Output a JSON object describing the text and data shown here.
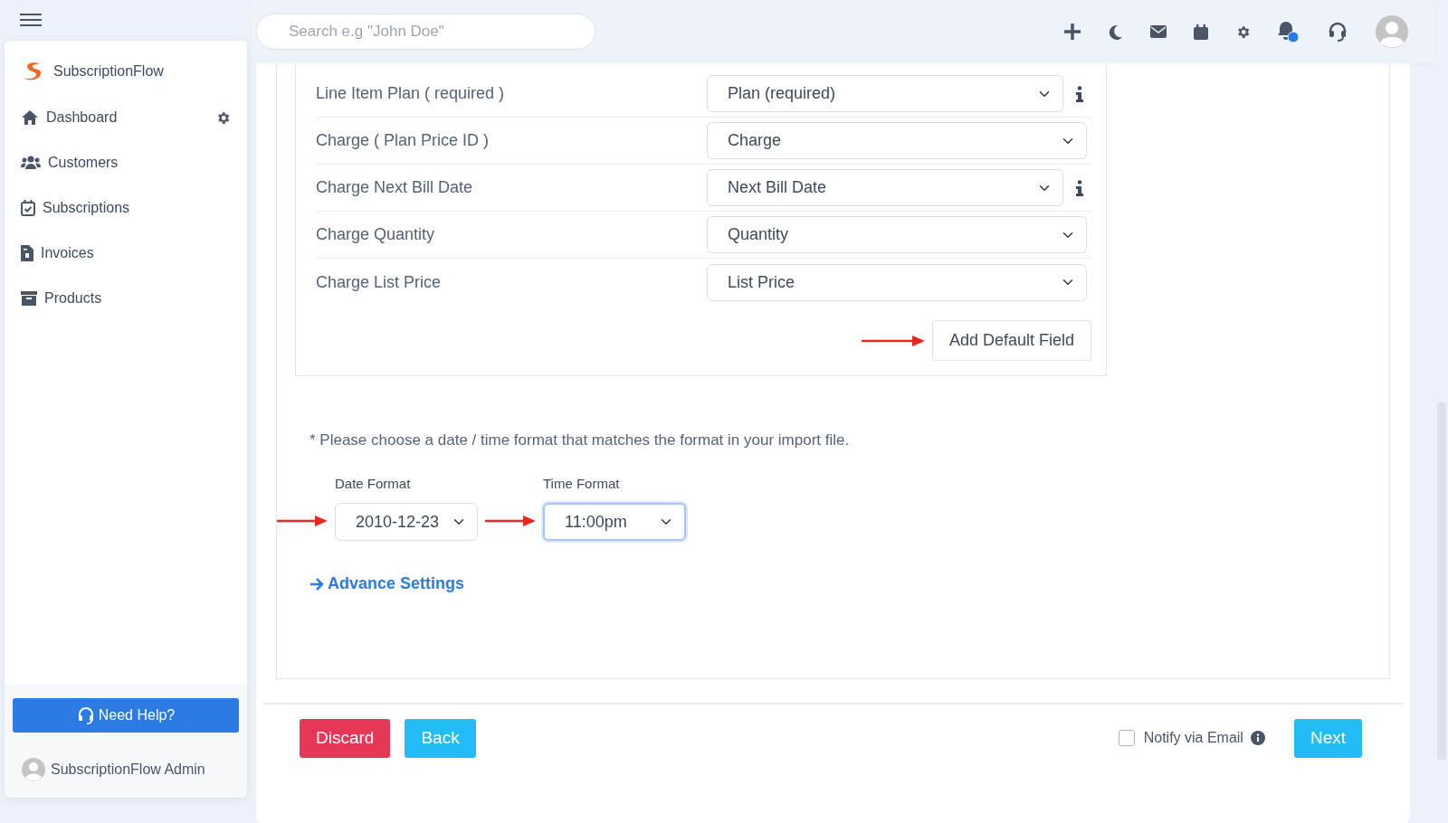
{
  "sidebar": {
    "brand": "SubscriptionFlow",
    "items": [
      {
        "label": "Dashboard",
        "selected": false,
        "settings": true
      },
      {
        "label": "Customers",
        "selected": false,
        "settings": false
      },
      {
        "label": "Subscriptions",
        "selected": false,
        "settings": false
      },
      {
        "label": "Invoices",
        "selected": false,
        "settings": false
      },
      {
        "label": "Products",
        "selected": false,
        "settings": false
      }
    ],
    "help_button": "Need Help?",
    "user": "SubscriptionFlow Admin"
  },
  "header": {
    "search": {
      "placeholder": "Search e.g \"John Doe\""
    },
    "unread": true
  },
  "mapping": {
    "rows": [
      {
        "label": "Line Item Plan ( required )",
        "value": "Plan (required)",
        "info": true
      },
      {
        "label": "Charge ( Plan Price ID )",
        "value": "Charge",
        "info": false
      },
      {
        "label": "Charge Next Bill Date",
        "value": "Next Bill Date",
        "info": true
      },
      {
        "label": "Charge Quantity",
        "value": "Quantity",
        "info": false
      },
      {
        "label": "Charge List Price",
        "value": "List Price",
        "info": false
      }
    ],
    "add_button": "Add Default Field"
  },
  "note": "* Please choose a date / time format that matches the format in your import file.",
  "formats": [
    {
      "label": "Date Format",
      "value": "2010-12-23",
      "focused": false
    },
    {
      "label": "Time Format",
      "value": "11:00pm",
      "focused": true
    }
  ],
  "advance_link": "Advance Settings",
  "footer": {
    "discard": "Discard",
    "back": "Back",
    "notify": {
      "label": "Notify via Email",
      "checked": false
    },
    "next": "Next"
  }
}
